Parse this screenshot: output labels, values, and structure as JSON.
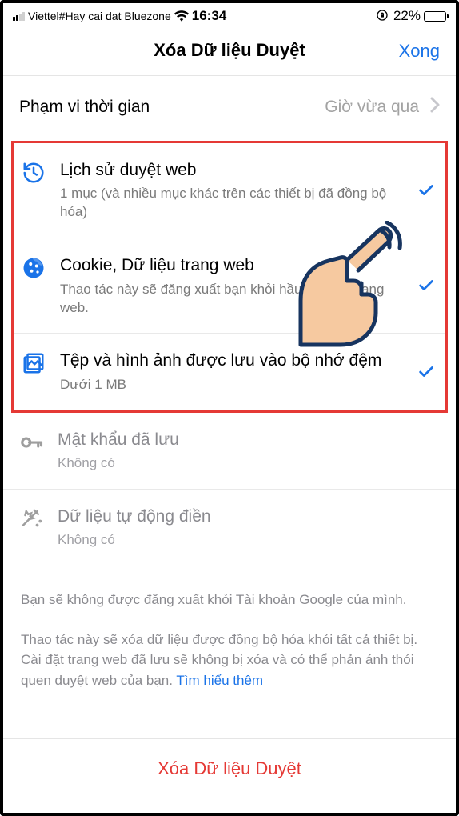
{
  "status": {
    "carrier": "Viettel#Hay cai dat Bluezone",
    "time": "16:34",
    "battery_pct": "22%"
  },
  "header": {
    "title": "Xóa Dữ liệu Duyệt",
    "done": "Xong"
  },
  "time_range": {
    "label": "Phạm vi thời gian",
    "value": "Giờ vừa qua"
  },
  "options": {
    "history": {
      "title": "Lịch sử duyệt web",
      "sub": "1 mục (và nhiều mục khác trên các thiết bị đã đồng bộ hóa)"
    },
    "cookies": {
      "title": "Cookie, Dữ liệu trang web",
      "sub": "Thao tác này sẽ đăng xuất bạn khỏi hầu hết các trang web."
    },
    "cache": {
      "title": "Tệp và hình ảnh được lưu vào bộ nhớ đệm",
      "sub": "Dưới 1 MB"
    },
    "passwords": {
      "title": "Mật khẩu đã lưu",
      "sub": "Không có"
    },
    "autofill": {
      "title": "Dữ liệu tự động điền",
      "sub": "Không có"
    }
  },
  "footer": {
    "line1": "Bạn sẽ không được đăng xuất khỏi Tài khoản Google của mình.",
    "line2": "Thao tác này sẽ xóa dữ liệu được đồng bộ hóa khỏi tất cả thiết bị. Cài đặt trang web đã lưu sẽ không bị xóa và có thể phản ánh thói quen duyệt web của bạn. ",
    "learn_more": "Tìm hiểu thêm"
  },
  "action": {
    "clear": "Xóa Dữ liệu Duyệt"
  },
  "colors": {
    "accent": "#1a73e8",
    "danger": "#e53935",
    "muted": "#8a8a8f"
  }
}
